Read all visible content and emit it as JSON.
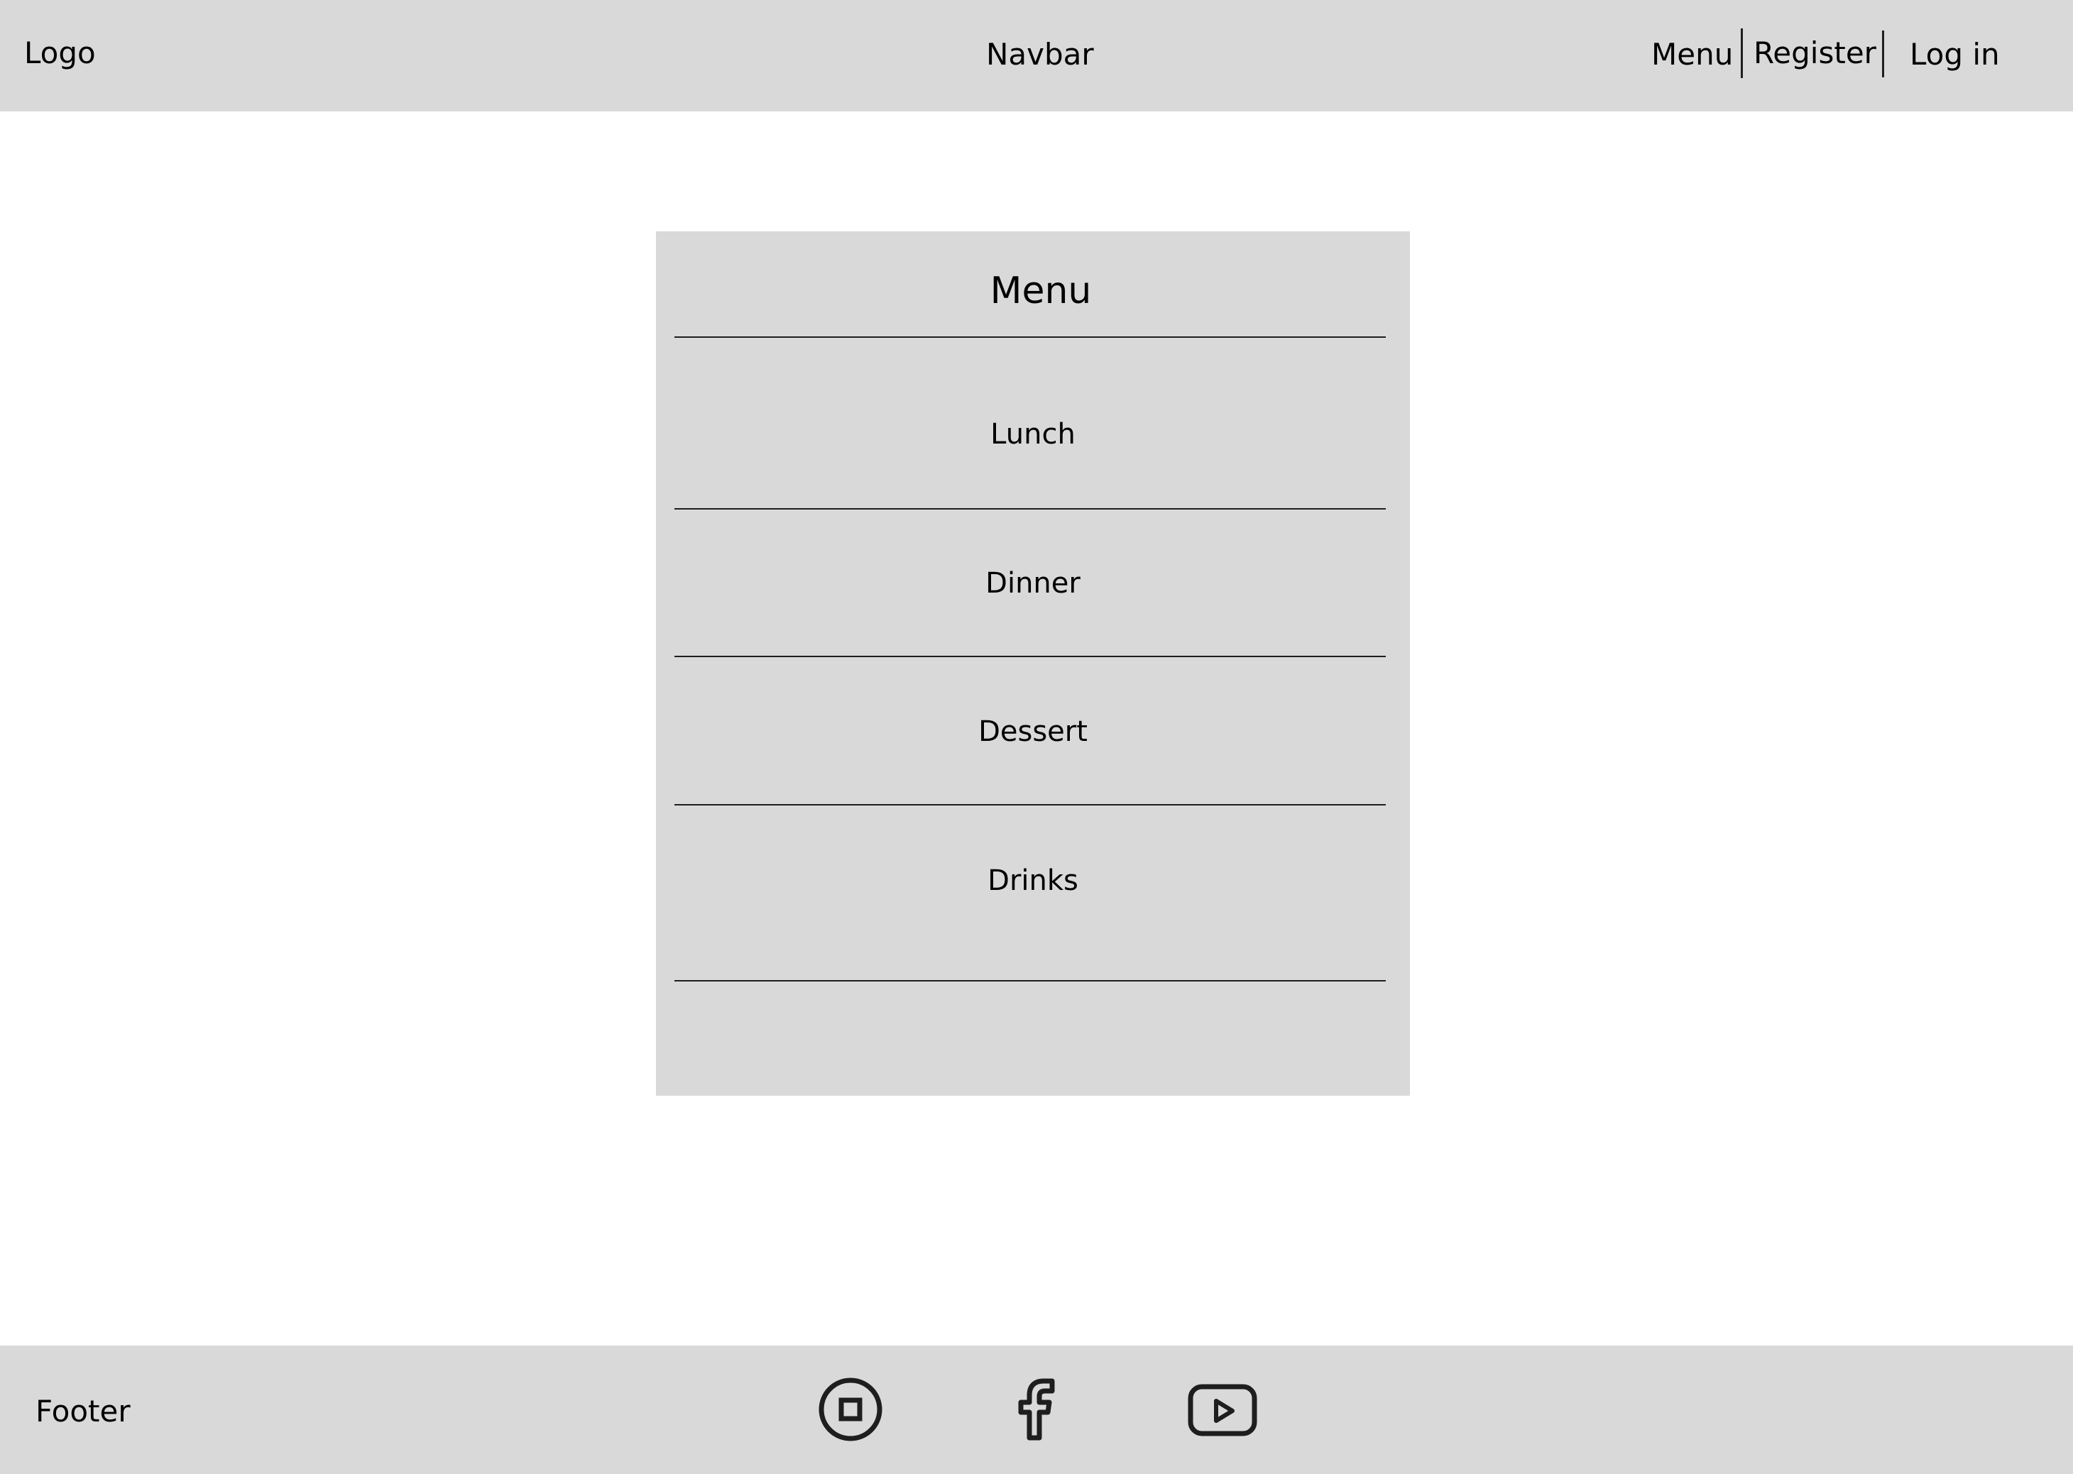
{
  "navbar": {
    "logo": "Logo",
    "title": "Navbar",
    "links": {
      "menu": "Menu",
      "register": "Register",
      "login": "Log in"
    }
  },
  "menu": {
    "title": "Menu",
    "items": [
      "Lunch",
      "Dinner",
      "Dessert",
      "Drinks"
    ]
  },
  "footer": {
    "label": "Footer",
    "social_icons": [
      "instagram-icon",
      "facebook-icon",
      "youtube-icon"
    ]
  },
  "colors": {
    "panel_background": "#d9d9d9",
    "page_background": "#ffffff",
    "line": "#1e1e1e"
  }
}
